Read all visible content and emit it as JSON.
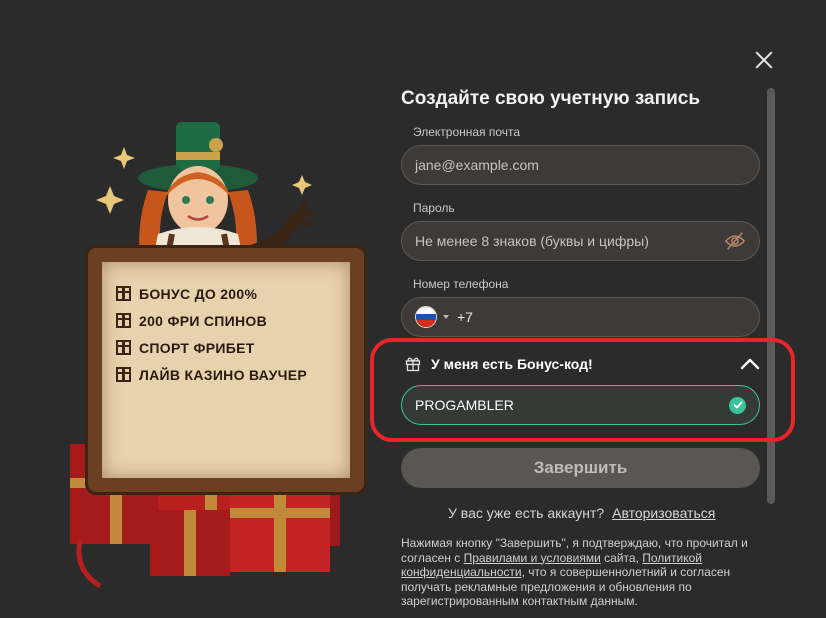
{
  "promo": {
    "items": [
      {
        "icon": "gift-icon",
        "text": "БОНУС ДО 200%"
      },
      {
        "icon": "gift-icon",
        "text": "200 ФРИ СПИНОВ"
      },
      {
        "icon": "gift-icon",
        "text": "СПОРТ ФРИБЕТ"
      },
      {
        "icon": "gift-icon",
        "text": "ЛАЙВ КАЗИНО ВАУЧЕР"
      }
    ]
  },
  "form": {
    "title": "Создайте свою учетную запись",
    "email": {
      "label": "Электронная почта",
      "placeholder": "jane@example.com",
      "value": ""
    },
    "password": {
      "label": "Пароль",
      "placeholder": "Не менее 8 знаков (буквы и цифры)",
      "value": ""
    },
    "phone": {
      "label": "Номер телефона",
      "country": "RU",
      "value": "+7"
    },
    "bonus": {
      "title": "У меня есть Бонус-код!",
      "expanded": true,
      "value": "PROGAMBLER",
      "valid": true
    },
    "submit_label": "Завершить",
    "login_prompt": "У вас уже есть аккаунт?",
    "login_link": "Авторизоваться",
    "terms": {
      "part1": "Нажимая кнопку \"Завершить\", я подтверждаю, что прочитал и согласен с ",
      "link1": "Правилами и условиями",
      "part2": " сайта, ",
      "link2": "Политикой конфиденциальности",
      "part3": ", что я совершеннолетний и согласен получать рекламные предложения и обновления по зарегистрированным контактным данным."
    }
  },
  "colors": {
    "background": "#2b2b2b",
    "accent_valid": "#3cc19a",
    "highlight": "#e8262a",
    "button_disabled": "#5a5652"
  }
}
